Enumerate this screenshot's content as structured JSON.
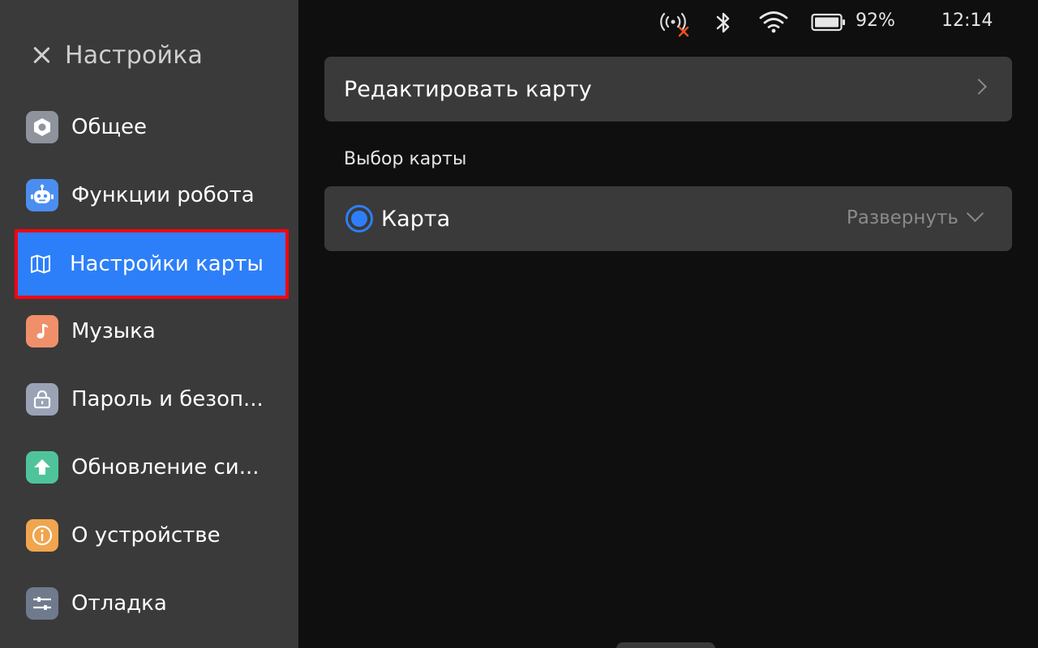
{
  "sidebar": {
    "title": "Настройка",
    "items": [
      {
        "label": "Общее",
        "icon": "general-icon",
        "color": "#8e939d"
      },
      {
        "label": "Функции робота",
        "icon": "robot-icon",
        "color": "#4b8ef0"
      },
      {
        "label": "Настройки карты",
        "icon": "map-icon",
        "color": "#2d7ff9",
        "active": true
      },
      {
        "label": "Музыка",
        "icon": "music-icon",
        "color": "#f0906a"
      },
      {
        "label": "Пароль и безоп...",
        "icon": "lock-icon",
        "color": "#9aa3b5"
      },
      {
        "label": "Обновление си...",
        "icon": "update-icon",
        "color": "#4fc49a"
      },
      {
        "label": "О устройстве",
        "icon": "info-icon",
        "color": "#f0a54e"
      },
      {
        "label": "Отладка",
        "icon": "debug-icon",
        "color": "#6f7a8c"
      }
    ]
  },
  "status_bar": {
    "battery_percent": "92%",
    "time": "12:14",
    "icons": [
      "signal-disconnected-icon",
      "bluetooth-icon",
      "wifi-icon",
      "battery-icon"
    ],
    "warning_color": "#e8551c"
  },
  "main": {
    "edit_map_label": "Редактировать карту",
    "section_label": "Выбор карты",
    "map_option_label": "Карта",
    "expand_label": "Развернуть"
  },
  "colors": {
    "accent": "#2d7ff9",
    "highlight_border": "#ff0011"
  }
}
